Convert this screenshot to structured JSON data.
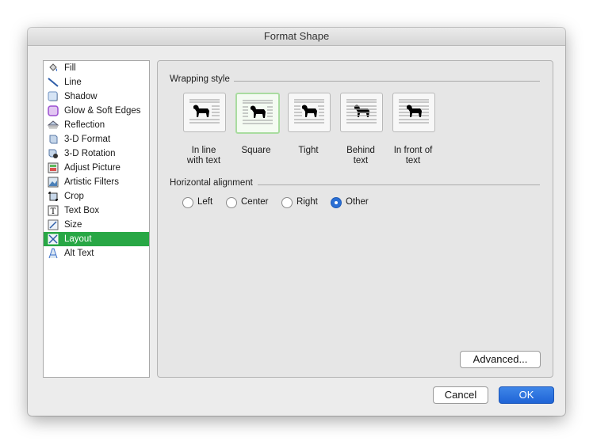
{
  "window": {
    "title": "Format Shape"
  },
  "sidebar": {
    "items": [
      {
        "label": "Fill",
        "icon": "fill-bucket-icon"
      },
      {
        "label": "Line",
        "icon": "line-icon"
      },
      {
        "label": "Shadow",
        "icon": "shadow-icon"
      },
      {
        "label": "Glow & Soft Edges",
        "icon": "glow-icon"
      },
      {
        "label": "Reflection",
        "icon": "reflection-icon"
      },
      {
        "label": "3-D Format",
        "icon": "3d-format-icon"
      },
      {
        "label": "3-D Rotation",
        "icon": "3d-rotation-icon"
      },
      {
        "label": "Adjust Picture",
        "icon": "adjust-picture-icon"
      },
      {
        "label": "Artistic Filters",
        "icon": "artistic-filters-icon"
      },
      {
        "label": "Crop",
        "icon": "crop-icon"
      },
      {
        "label": "Text Box",
        "icon": "text-box-icon"
      },
      {
        "label": "Size",
        "icon": "size-icon"
      },
      {
        "label": "Layout",
        "icon": "layout-icon",
        "selected": true
      },
      {
        "label": "Alt Text",
        "icon": "alt-text-icon"
      }
    ],
    "selected_color": "#28a745"
  },
  "wrapping": {
    "title": "Wrapping style",
    "options": [
      {
        "label_line1": "In line",
        "label_line2": "with text"
      },
      {
        "label_line1": "Square",
        "label_line2": "",
        "selected": true
      },
      {
        "label_line1": "Tight",
        "label_line2": ""
      },
      {
        "label_line1": "Behind",
        "label_line2": "text"
      },
      {
        "label_line1": "In front of",
        "label_line2": "text"
      }
    ]
  },
  "alignment": {
    "title": "Horizontal alignment",
    "options": [
      "Left",
      "Center",
      "Right",
      "Other"
    ],
    "selected": "Other"
  },
  "buttons": {
    "advanced": "Advanced...",
    "cancel": "Cancel",
    "ok": "OK"
  }
}
